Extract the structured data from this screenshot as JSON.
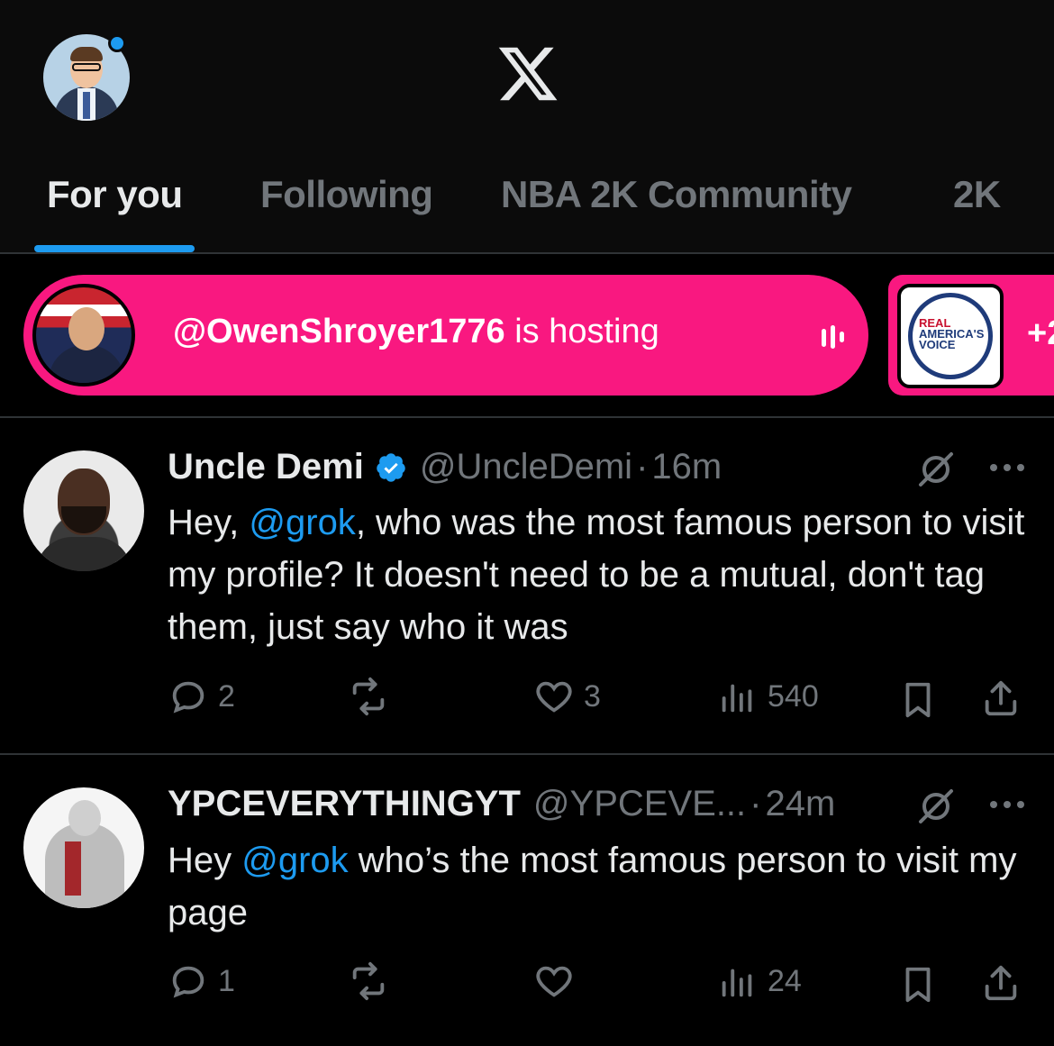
{
  "header": {
    "logo_icon": "x-logo-icon",
    "notification_dot_color": "#1d9bf0"
  },
  "tabs": [
    {
      "label": "For you",
      "active": true
    },
    {
      "label": "Following",
      "active": false
    },
    {
      "label": "NBA 2K Community",
      "active": false
    },
    {
      "label": "2K",
      "active": false
    }
  ],
  "spaces": {
    "host_handle": "@OwenShroyer1776",
    "host_suffix": "is hosting",
    "second_card_logo_text": [
      "REAL",
      "AMERICA'S",
      "VOICE"
    ],
    "more_label": "+2",
    "accent_color": "#f91880"
  },
  "posts": [
    {
      "name": "Uncle Demi",
      "verified": true,
      "handle": "@UncleDemi",
      "separator": "·",
      "time": "16m",
      "text_parts": [
        "Hey, ",
        "@grok",
        ", who was the most famous person to visit my profile? It doesn't need to be a mutual, don't tag them, just say who it was"
      ],
      "replies": "2",
      "reposts": "",
      "likes": "3",
      "views": "540"
    },
    {
      "name": "YPCEVERYTHINGYT",
      "verified": false,
      "handle": "@YPCEVE...",
      "separator": "·",
      "time": "24m",
      "text_parts": [
        "Hey ",
        "@grok",
        " who’s the most famous person to visit my page"
      ],
      "replies": "1",
      "reposts": "",
      "likes": "",
      "views": "24"
    }
  ]
}
